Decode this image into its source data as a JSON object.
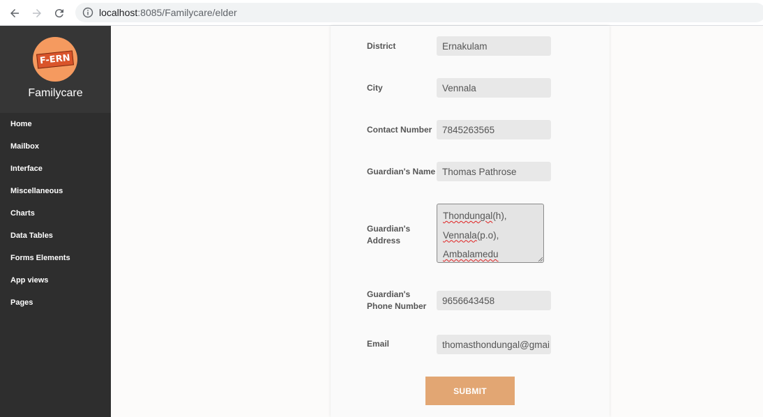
{
  "browser": {
    "url_host": "localhost",
    "url_path": ":8085/Familycare/elder"
  },
  "sidebar": {
    "logo_text": "F-ERN",
    "brand": "Familycare",
    "items": [
      {
        "label": "Home"
      },
      {
        "label": "Mailbox"
      },
      {
        "label": "Interface"
      },
      {
        "label": "Miscellaneous"
      },
      {
        "label": "Charts"
      },
      {
        "label": "Data Tables"
      },
      {
        "label": "Forms Elements"
      },
      {
        "label": "App views"
      },
      {
        "label": "Pages"
      }
    ]
  },
  "form": {
    "district": {
      "label": "District",
      "value": "Ernakulam"
    },
    "city": {
      "label": "City",
      "value": "Vennala"
    },
    "contact": {
      "label": "Contact Number",
      "value": "7845263565"
    },
    "guardian_name": {
      "label": "Guardian's Name",
      "value": "Thomas Pathrose"
    },
    "guardian_address": {
      "label_line1": "Guardian's",
      "label_line2": "Address",
      "lines": [
        {
          "word": "Thondungal",
          "rest": "(h),"
        },
        {
          "word": "Vennala",
          "rest": "(p.o),"
        },
        {
          "word": "Ambalamedu",
          "rest": ""
        }
      ]
    },
    "guardian_phone": {
      "label_line1": "Guardian's",
      "label_line2": "Phone Number",
      "value": "9656643458"
    },
    "email": {
      "label": "Email",
      "value": "thomasthondungal@gmail"
    },
    "submit_label": "SUBMIT"
  },
  "colors": {
    "sidebar_bg": "#2e2e2e",
    "submit_bg": "#e2a673",
    "field_bg": "#e8e8e8"
  }
}
